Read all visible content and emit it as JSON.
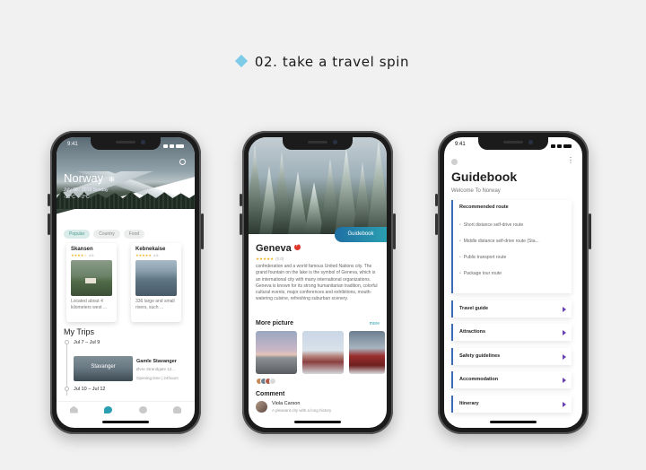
{
  "heading": "02. take a travel spin",
  "screen1": {
    "time": "9:41",
    "city": "Norway",
    "weather_symbol": "❄",
    "date": "July 08 , 2019 Sunday",
    "temperature": "-10°C ~ -2°C",
    "chips": [
      "Popular",
      "Country",
      "Food"
    ],
    "places": [
      {
        "name": "Skansen",
        "stars": "★★★★☆",
        "score": "4.6",
        "desc_lines": [
          "Located about 4",
          "kilometers west ..."
        ]
      },
      {
        "name": "Kebnekaise",
        "stars": "★★★★★",
        "score": "4.8",
        "desc_lines": [
          "336 large and small",
          "rivers, such ..."
        ]
      }
    ],
    "trips_title": "My Trips",
    "trips": [
      {
        "date": "Jul 7 – Jul 9",
        "img_label": "Stavanger",
        "name": "Gamle Stavanger",
        "sub": "Øvre Strandgate 12...",
        "time": "Opening time | 24hours"
      },
      {
        "date": "Jul 10 – Jul 12"
      }
    ],
    "tab_icons": [
      "home-icon",
      "location-icon",
      "chat-icon",
      "profile-icon"
    ]
  },
  "screen2": {
    "button": "Guidebook",
    "city": "Geneva",
    "stars": "★★★★★",
    "rating_note": "(0.0)",
    "description": "confederation and a world famous United Nations city. The grand fountain on the lake is the symbol of Geneva, which is an international city with many international organizations. Geneva is known for its strong humanitarian tradition, colorful cultural events, major conferences and exhibitions, mouth-watering cuisine, refreshing suburban scenery.",
    "more_picture": "More picture",
    "more_link": "more",
    "comment_title": "Comment",
    "commenter": "Viola Carson",
    "comment": "A pleasant city with a long history"
  },
  "screen3": {
    "time": "9:41",
    "title": "Guidebook",
    "subtitle": "Welcome To Norway",
    "section_title": "Recommended route",
    "routes": [
      "Short distance self-drive route",
      "Middle distance self-drive route (Sta...",
      "Public transport route",
      "Package tour route"
    ],
    "rows": [
      "Travel guide",
      "Attractions",
      "Safety guidelines",
      "Accommodation",
      "Itinerary"
    ]
  },
  "colors": {
    "accent": "#2a9fb1",
    "highlight": "#3e6ab8",
    "arrow": "#6a3fb3",
    "star": "#f0b429"
  }
}
